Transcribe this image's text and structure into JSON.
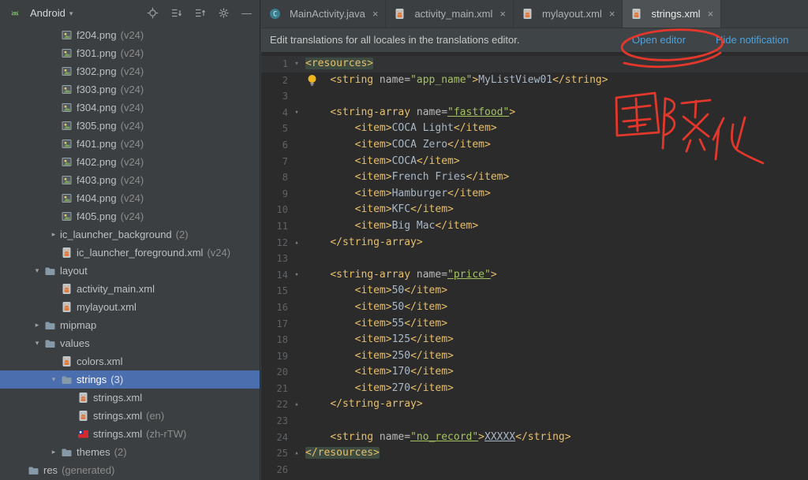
{
  "panel": {
    "title": "Android",
    "toolbar": [
      {
        "name": "locate"
      },
      {
        "name": "expand-all"
      },
      {
        "name": "collapse-all"
      },
      {
        "name": "settings"
      },
      {
        "name": "minimize"
      }
    ]
  },
  "icons": {
    "dropdown": "▾",
    "chevron_down": "▾",
    "chevron_right": "▸",
    "close": "×",
    "check": "✔",
    "fold_down": "▾",
    "fold_up": "▴",
    "minimize": "—"
  },
  "tree": {
    "items": [
      {
        "label": "f204.png",
        "suffix": "(v24)",
        "icon": "image-file",
        "level": 3
      },
      {
        "label": "f301.png",
        "suffix": "(v24)",
        "icon": "image-file",
        "level": 3
      },
      {
        "label": "f302.png",
        "suffix": "(v24)",
        "icon": "image-file",
        "level": 3
      },
      {
        "label": "f303.png",
        "suffix": "(v24)",
        "icon": "image-file",
        "level": 3
      },
      {
        "label": "f304.png",
        "suffix": "(v24)",
        "icon": "image-file",
        "level": 3
      },
      {
        "label": "f305.png",
        "suffix": "(v24)",
        "icon": "image-file",
        "level": 3
      },
      {
        "label": "f401.png",
        "suffix": "(v24)",
        "icon": "image-file",
        "level": 3
      },
      {
        "label": "f402.png",
        "suffix": "(v24)",
        "icon": "image-file",
        "level": 3
      },
      {
        "label": "f403.png",
        "suffix": "(v24)",
        "icon": "image-file",
        "level": 3
      },
      {
        "label": "f404.png",
        "suffix": "(v24)",
        "icon": "image-file",
        "level": 3
      },
      {
        "label": "f405.png",
        "suffix": "(v24)",
        "icon": "image-file",
        "level": 3
      },
      {
        "label": "ic_launcher_background",
        "suffix": "(2)",
        "chevron": "right",
        "level": 3
      },
      {
        "label": "ic_launcher_foreground.xml",
        "suffix": "(v24)",
        "icon": "android-file",
        "level": 3
      },
      {
        "label": "layout",
        "icon": "folder",
        "chevron": "down",
        "level": 2
      },
      {
        "label": "activity_main.xml",
        "icon": "android-file",
        "level": 3
      },
      {
        "label": "mylayout.xml",
        "icon": "android-file",
        "level": 3
      },
      {
        "label": "mipmap",
        "icon": "folder",
        "chevron": "right",
        "level": 2
      },
      {
        "label": "values",
        "icon": "folder",
        "chevron": "down",
        "level": 2
      },
      {
        "label": "colors.xml",
        "icon": "android-file",
        "level": 3
      },
      {
        "label": "strings",
        "suffix": "(3)",
        "icon": "folder",
        "chevron": "down",
        "level": 3,
        "selected": true
      },
      {
        "label": "strings.xml",
        "icon": "android-file",
        "level": 4
      },
      {
        "label": "strings.xml",
        "suffix": "(en)",
        "icon": "android-file",
        "level": 4
      },
      {
        "label": "strings.xml",
        "suffix": "(zh-rTW)",
        "icon": "flag-taiwan",
        "level": 4
      },
      {
        "label": "themes",
        "suffix": "(2)",
        "icon": "folder",
        "chevron": "right",
        "level": 3
      },
      {
        "label": "res",
        "suffix": "(generated)",
        "icon": "folder",
        "level": 1
      }
    ]
  },
  "tabs": [
    {
      "label": "MainActivity.java",
      "icon": "java-class",
      "active": false
    },
    {
      "label": "activity_main.xml",
      "icon": "android-file",
      "active": false
    },
    {
      "label": "mylayout.xml",
      "icon": "android-file",
      "active": false
    },
    {
      "label": "strings.xml",
      "icon": "android-file",
      "active": true
    }
  ],
  "notification": {
    "message": "Edit translations for all locales in the translations editor.",
    "open_editor": "Open editor",
    "hide": "Hide notification"
  },
  "editor": {
    "inspection_count": "2",
    "lines": [
      {
        "n": 1,
        "caret": true,
        "fold": "down",
        "tokens": [
          {
            "c": "taghl",
            "t": "<resources>"
          }
        ]
      },
      {
        "n": 2,
        "bulb": true,
        "tokens": [
          {
            "c": "p",
            "t": "    "
          },
          {
            "c": "tag",
            "t": "<string"
          },
          {
            "c": "attr",
            "t": " name="
          },
          {
            "c": "val",
            "t": "\"app_name\""
          },
          {
            "c": "tag",
            "t": ">"
          },
          {
            "c": "txt",
            "t": "MyListView01"
          },
          {
            "c": "tag",
            "t": "</string>"
          }
        ]
      },
      {
        "n": 3,
        "tokens": []
      },
      {
        "n": 4,
        "fold": "down",
        "tokens": [
          {
            "c": "p",
            "t": "    "
          },
          {
            "c": "tag",
            "t": "<string-array"
          },
          {
            "c": "attr",
            "t": " name="
          },
          {
            "c": "valu",
            "t": "\"fastfood\""
          },
          {
            "c": "tag",
            "t": ">"
          }
        ]
      },
      {
        "n": 5,
        "tokens": [
          {
            "c": "p",
            "t": "        "
          },
          {
            "c": "tag",
            "t": "<item>"
          },
          {
            "c": "txt",
            "t": "COCA Light"
          },
          {
            "c": "tag",
            "t": "</item>"
          }
        ]
      },
      {
        "n": 6,
        "tokens": [
          {
            "c": "p",
            "t": "        "
          },
          {
            "c": "tag",
            "t": "<item>"
          },
          {
            "c": "txt",
            "t": "COCA Zero"
          },
          {
            "c": "tag",
            "t": "</item>"
          }
        ]
      },
      {
        "n": 7,
        "tokens": [
          {
            "c": "p",
            "t": "        "
          },
          {
            "c": "tag",
            "t": "<item>"
          },
          {
            "c": "txt",
            "t": "COCA"
          },
          {
            "c": "tag",
            "t": "</item>"
          }
        ]
      },
      {
        "n": 8,
        "tokens": [
          {
            "c": "p",
            "t": "        "
          },
          {
            "c": "tag",
            "t": "<item>"
          },
          {
            "c": "txt",
            "t": "French Fries"
          },
          {
            "c": "tag",
            "t": "</item>"
          }
        ]
      },
      {
        "n": 9,
        "tokens": [
          {
            "c": "p",
            "t": "        "
          },
          {
            "c": "tag",
            "t": "<item>"
          },
          {
            "c": "txt",
            "t": "Hamburger"
          },
          {
            "c": "tag",
            "t": "</item>"
          }
        ]
      },
      {
        "n": 10,
        "tokens": [
          {
            "c": "p",
            "t": "        "
          },
          {
            "c": "tag",
            "t": "<item>"
          },
          {
            "c": "txt",
            "t": "KFC"
          },
          {
            "c": "tag",
            "t": "</item>"
          }
        ]
      },
      {
        "n": 11,
        "tokens": [
          {
            "c": "p",
            "t": "        "
          },
          {
            "c": "tag",
            "t": "<item>"
          },
          {
            "c": "txt",
            "t": "Big Mac"
          },
          {
            "c": "tag",
            "t": "</item>"
          }
        ]
      },
      {
        "n": 12,
        "fold": "up",
        "tokens": [
          {
            "c": "p",
            "t": "    "
          },
          {
            "c": "tag",
            "t": "</string-array>"
          }
        ]
      },
      {
        "n": 13,
        "tokens": []
      },
      {
        "n": 14,
        "fold": "down",
        "tokens": [
          {
            "c": "p",
            "t": "    "
          },
          {
            "c": "tag",
            "t": "<string-array"
          },
          {
            "c": "attr",
            "t": " name="
          },
          {
            "c": "valu",
            "t": "\"price\""
          },
          {
            "c": "tag",
            "t": ">"
          }
        ]
      },
      {
        "n": 15,
        "tokens": [
          {
            "c": "p",
            "t": "        "
          },
          {
            "c": "tag",
            "t": "<item>"
          },
          {
            "c": "txt",
            "t": "50"
          },
          {
            "c": "tag",
            "t": "</item>"
          }
        ]
      },
      {
        "n": 16,
        "tokens": [
          {
            "c": "p",
            "t": "        "
          },
          {
            "c": "tag",
            "t": "<item>"
          },
          {
            "c": "txt",
            "t": "50"
          },
          {
            "c": "tag",
            "t": "</item>"
          }
        ]
      },
      {
        "n": 17,
        "tokens": [
          {
            "c": "p",
            "t": "        "
          },
          {
            "c": "tag",
            "t": "<item>"
          },
          {
            "c": "txt",
            "t": "55"
          },
          {
            "c": "tag",
            "t": "</item>"
          }
        ]
      },
      {
        "n": 18,
        "tokens": [
          {
            "c": "p",
            "t": "        "
          },
          {
            "c": "tag",
            "t": "<item>"
          },
          {
            "c": "txt",
            "t": "125"
          },
          {
            "c": "tag",
            "t": "</item>"
          }
        ]
      },
      {
        "n": 19,
        "tokens": [
          {
            "c": "p",
            "t": "        "
          },
          {
            "c": "tag",
            "t": "<item>"
          },
          {
            "c": "txt",
            "t": "250"
          },
          {
            "c": "tag",
            "t": "</item>"
          }
        ]
      },
      {
        "n": 20,
        "tokens": [
          {
            "c": "p",
            "t": "        "
          },
          {
            "c": "tag",
            "t": "<item>"
          },
          {
            "c": "txt",
            "t": "170"
          },
          {
            "c": "tag",
            "t": "</item>"
          }
        ]
      },
      {
        "n": 21,
        "tokens": [
          {
            "c": "p",
            "t": "        "
          },
          {
            "c": "tag",
            "t": "<item>"
          },
          {
            "c": "txt",
            "t": "270"
          },
          {
            "c": "tag",
            "t": "</item>"
          }
        ]
      },
      {
        "n": 22,
        "fold": "up",
        "tokens": [
          {
            "c": "p",
            "t": "    "
          },
          {
            "c": "tag",
            "t": "</string-array>"
          }
        ]
      },
      {
        "n": 23,
        "tokens": []
      },
      {
        "n": 24,
        "tokens": [
          {
            "c": "p",
            "t": "    "
          },
          {
            "c": "tag",
            "t": "<string"
          },
          {
            "c": "attr",
            "t": " name="
          },
          {
            "c": "valu",
            "t": "\"no_record\""
          },
          {
            "c": "tag",
            "t": ">"
          },
          {
            "c": "txtu",
            "t": "XXXXX"
          },
          {
            "c": "tag",
            "t": "</string>"
          }
        ]
      },
      {
        "n": 25,
        "fold": "up",
        "tokens": [
          {
            "c": "taghl",
            "t": "</resources>"
          }
        ]
      },
      {
        "n": 26,
        "tokens": []
      }
    ]
  },
  "annotations": {
    "handwriting": "國際化"
  }
}
